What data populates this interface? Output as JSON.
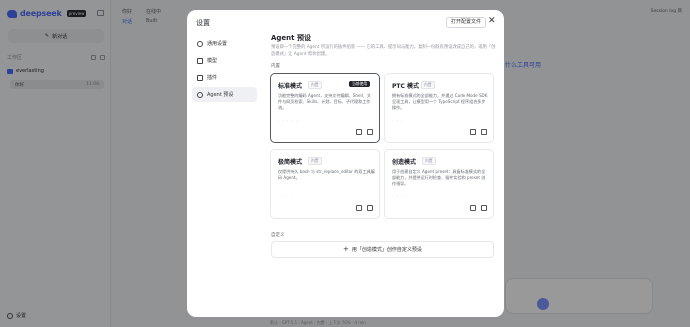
{
  "background": {
    "brand": {
      "name": "deepseek",
      "badge": "preview"
    },
    "new_chat_label": "新对话",
    "workspace_label": "工作区",
    "folder_name": "everlasting",
    "session": {
      "name": "你好",
      "time": "11:08"
    },
    "settings_label": "设置",
    "topbar_tabs": [
      "你好",
      "在线中"
    ],
    "topbar_subtabs": [
      "对话",
      "Built"
    ],
    "session_log": "Session log 目",
    "hint_text": "什么工具可用",
    "status_text": "默认 · GPT-5.1 · Agent · 内置 · 上下文 76% · 4 min"
  },
  "modal": {
    "title": "设置",
    "open_config_label": "打开配置文件",
    "close_label": "✕",
    "nav": [
      {
        "label": "通用设置",
        "icon": "gear-icon"
      },
      {
        "label": "模型",
        "icon": "cube-icon"
      },
      {
        "label": "插件",
        "icon": "puzzle-icon"
      },
      {
        "label": "Agent 预设",
        "icon": "agent-icon"
      }
    ],
    "section_title": "Agent 预设",
    "section_desc": "预设即一个完整的 Agent 所运行的插件组装 —— 它的工具、提示词与能力。复制一份既有预设改成自己的，或用「创造模式」让 Agent 帮你创建。",
    "builtin_label": "内置",
    "custom_label": "自定义",
    "cards": [
      {
        "title": "标准模式",
        "tag": "内置",
        "active_badge": "当前使用",
        "desc": "功能完整的编码 Agent，支持文件编辑、Shell、文件与网页检索、Skills、计划、目标、子代理和工作流。",
        "dots": "· · · · ·"
      },
      {
        "title": "PTC 模式",
        "tag": "内置",
        "desc": "拥有标准模式的全部能力，并通过 Code Mode SDK 呈现工具，让模型用一个 TypeScript 程序组合多步操作。",
        "dots": "· · ·"
      },
      {
        "title": "极简模式",
        "tag": "内置",
        "desc": "仅提供持久 bash 与 str_replace_editor 的双工具编码 Agent。",
        "dots": "· · · ·"
      },
      {
        "title": "创造模式",
        "tag": "内置",
        "desc": "用于创建自定义 Agent preset：具备标准模式的全部能力，并提供运行时检查、插件实验和 preset 创作指导。",
        "dots": "· · · ·"
      }
    ],
    "create_custom_label": "用「创造模式」创作自定义预设",
    "create_custom_plus": "+"
  }
}
